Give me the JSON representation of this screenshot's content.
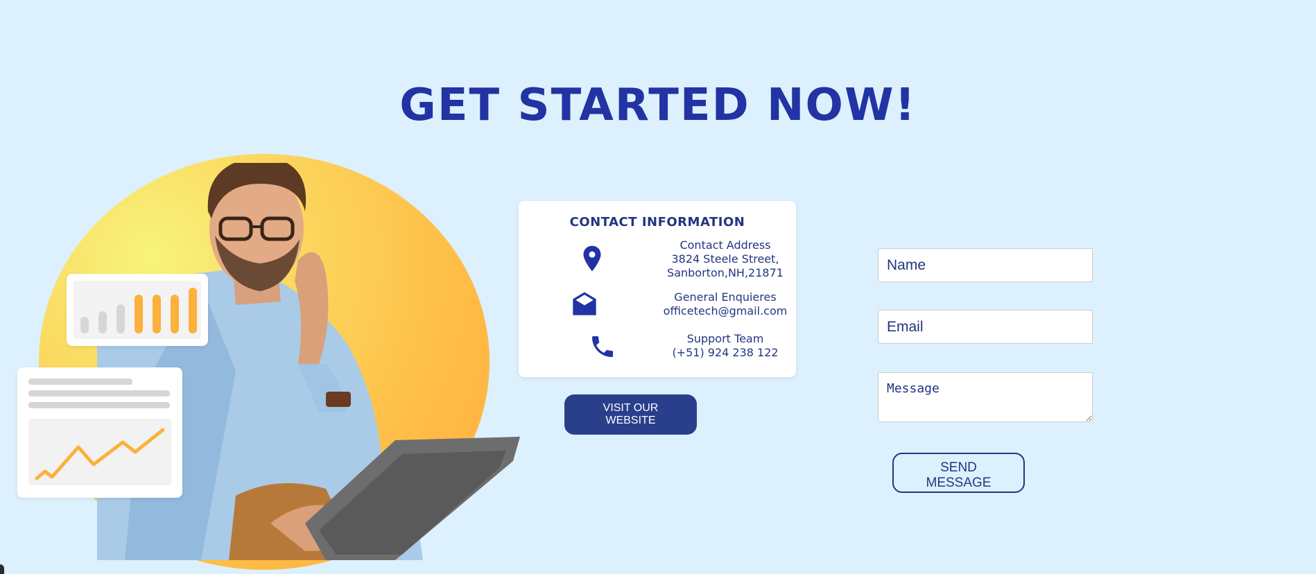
{
  "hero": {
    "title": "GET STARTED NOW!"
  },
  "contact": {
    "title": "CONTACT INFORMATION",
    "address": {
      "icon": "location-pin-icon",
      "label": "Contact Address",
      "line1": "3824 Steele Street,",
      "line2": "Sanborton,NH,21871"
    },
    "email": {
      "icon": "envelope-open-icon",
      "label": "General Enquieres",
      "value": "officetech@gmail.com"
    },
    "support": {
      "icon": "phone-icon",
      "label": "Support Team",
      "value": "(+51) 924 238 122"
    },
    "visit_button": "VISIT OUR WEBSITE"
  },
  "form": {
    "name_placeholder": "Name",
    "email_placeholder": "Email",
    "message_placeholder": "Message",
    "send_button": "SEND MESSAGE"
  },
  "colors": {
    "background": "#ddf0fd",
    "heading": "#2233a3",
    "primary": "#2a3f8c",
    "text": "#23357f",
    "accent_orange": "#ffb13f",
    "accent_yellow": "#f7f47c"
  }
}
